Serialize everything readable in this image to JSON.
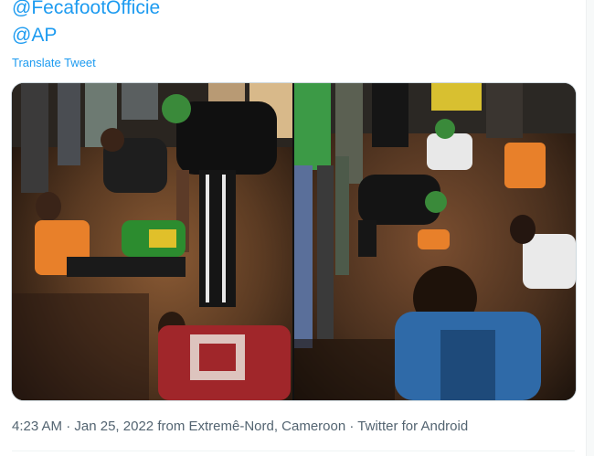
{
  "tweet": {
    "mention_1": "@FecafootOfficie",
    "mention_2": "@AP",
    "translate_label": "Translate Tweet",
    "media": [
      {
        "name": "left-photo"
      },
      {
        "name": "right-photo"
      }
    ],
    "meta": {
      "time": "4:23 AM",
      "date": "Jan 25, 2022",
      "from_text": "from",
      "location": "Extremê-Nord, Cameroon",
      "separator": "·",
      "source": "Twitter for Android"
    }
  },
  "colors": {
    "link": "#1d9bf0",
    "meta_text": "#536471",
    "border": "#cfd9de"
  }
}
